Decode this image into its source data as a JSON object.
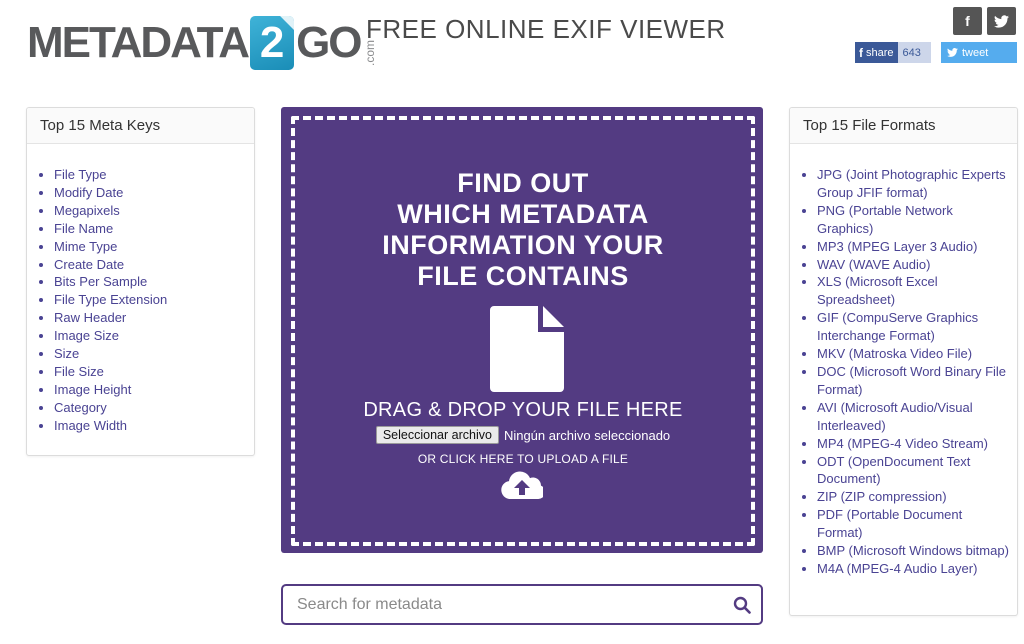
{
  "logo": {
    "part1": "METADATA",
    "mid": "2",
    "part2": "GO",
    "suffix": ".com"
  },
  "page_title": "FREE ONLINE EXIF VIEWER",
  "social": {
    "facebook_glyph": "f",
    "share_label": "share",
    "share_count": "643",
    "tweet_label": "tweet"
  },
  "left_box": {
    "title": "Top 15 Meta Keys",
    "items": [
      "File Type",
      "Modify Date",
      "Megapixels",
      "File Name",
      "Mime Type",
      "Create Date",
      "Bits Per Sample",
      "File Type Extension",
      "Raw Header",
      "Image Size",
      "Size",
      "File Size",
      "Image Height",
      "Category",
      "Image Width"
    ]
  },
  "right_box": {
    "title": "Top 15 File Formats",
    "items": [
      "JPG (Joint Photographic Experts Group JFIF format)",
      "PNG (Portable Network Graphics)",
      "MP3 (MPEG Layer 3 Audio)",
      "WAV (WAVE Audio)",
      "XLS (Microsoft Excel Spreadsheet)",
      "GIF (CompuServe Graphics Interchange Format)",
      "MKV (Matroska Video File)",
      "DOC (Microsoft Word Binary File Format)",
      "AVI (Microsoft Audio/Visual Interleaved)",
      "MP4 (MPEG-4 Video Stream)",
      "ODT (OpenDocument Text Document)",
      "ZIP (ZIP compression)",
      "PDF (Portable Document Format)",
      "BMP (Microsoft Windows bitmap)",
      "M4A (MPEG-4 Audio Layer)"
    ]
  },
  "dropzone": {
    "heading_lines": [
      "FIND OUT",
      "WHICH METADATA",
      "INFORMATION YOUR",
      "FILE CONTAINS"
    ],
    "drag_text": "DRAG & DROP YOUR FILE HERE",
    "file_button": "Seleccionar archivo",
    "file_status": "Ningún archivo seleccionado",
    "click_text": "OR CLICK HERE TO UPLOAD A FILE"
  },
  "search": {
    "placeholder": "Search for metadata"
  },
  "colors": {
    "accent": "#533b82",
    "link": "#4a4393",
    "facebook": "#3b5998",
    "twitter": "#55acee",
    "logo_blue": "#1a8db7"
  },
  "icons": [
    "facebook-icon",
    "twitter-icon",
    "file-icon",
    "cloud-upload-icon",
    "search-icon"
  ]
}
